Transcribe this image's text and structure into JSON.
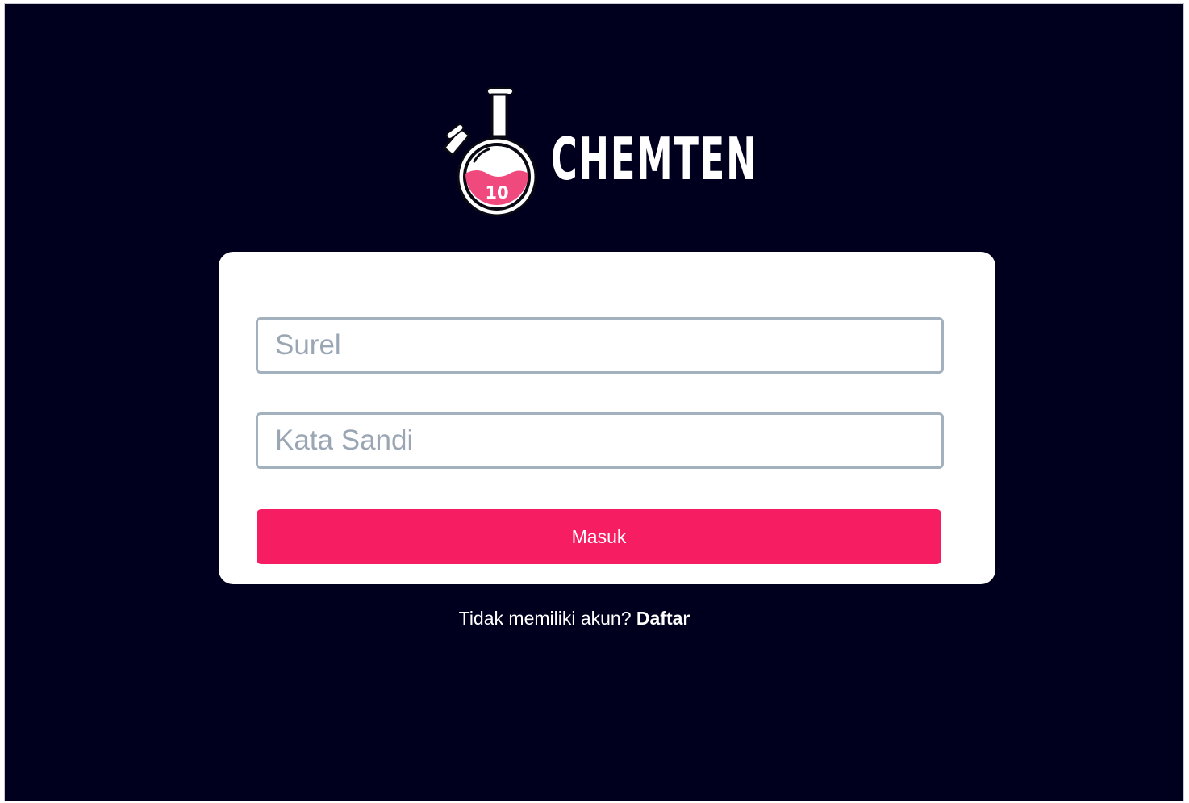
{
  "brand": {
    "name": "CHEMTEN",
    "logo_badge": "10",
    "logo_icon": "round-bottom-flask-icon"
  },
  "login_form": {
    "email_placeholder": "Surel",
    "email_value": "",
    "password_placeholder": "Kata Sandi",
    "password_value": "",
    "submit_label": "Masuk"
  },
  "signup": {
    "prompt": "Tidak memiliki akun?",
    "link_label": "Daftar"
  },
  "colors": {
    "background": "#00001e",
    "card": "#ffffff",
    "accent": "#f71d63",
    "input_border": "#a3b0be",
    "placeholder": "#9aa6b3"
  }
}
